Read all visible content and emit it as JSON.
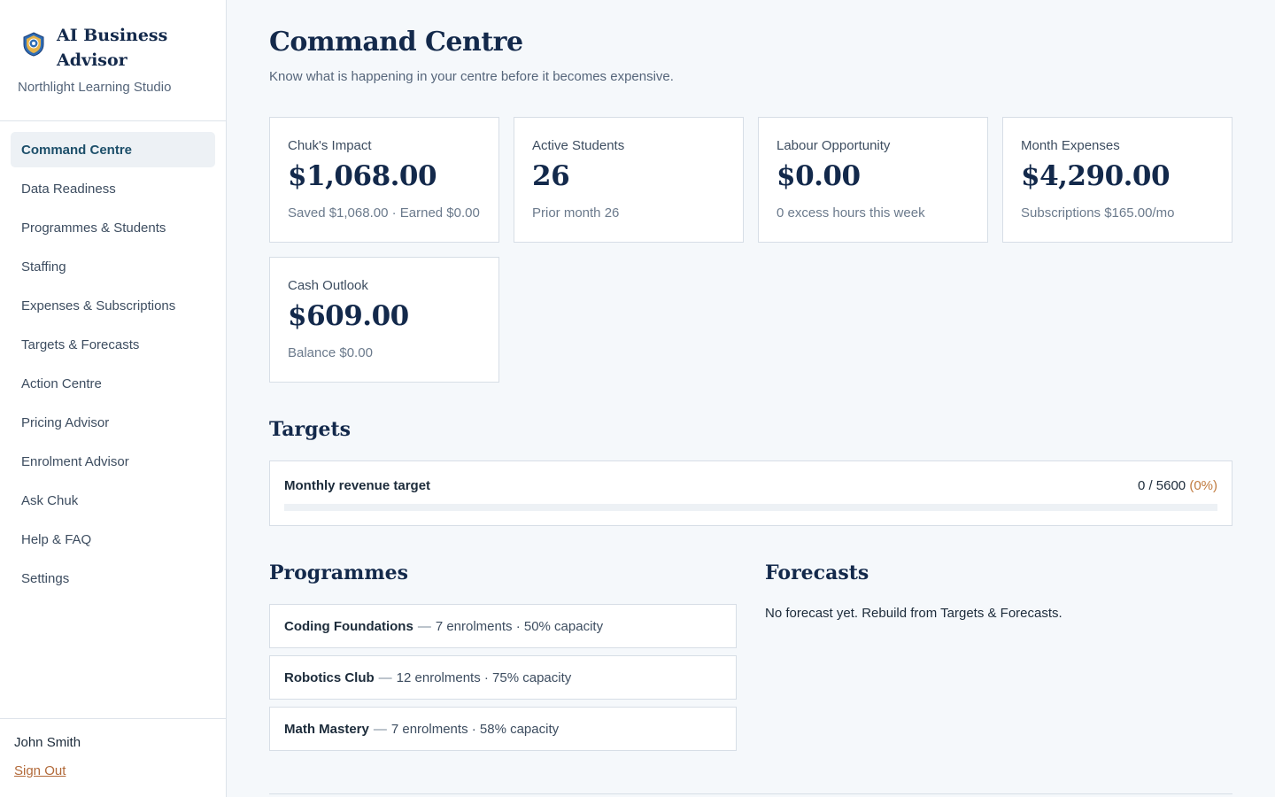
{
  "brand": {
    "title": "AI Business Advisor",
    "org": "Northlight Learning Studio"
  },
  "nav": {
    "items": [
      {
        "label": "Command Centre",
        "active": true
      },
      {
        "label": "Data Readiness"
      },
      {
        "label": "Programmes & Students"
      },
      {
        "label": "Staffing"
      },
      {
        "label": "Expenses & Subscriptions"
      },
      {
        "label": "Targets & Forecasts"
      },
      {
        "label": "Action Centre"
      },
      {
        "label": "Pricing Advisor"
      },
      {
        "label": "Enrolment Advisor"
      },
      {
        "label": "Ask Chuk"
      },
      {
        "label": "Help & FAQ"
      },
      {
        "label": "Settings"
      }
    ]
  },
  "user": {
    "name": "John Smith",
    "sign_out": "Sign Out"
  },
  "page": {
    "title": "Command Centre",
    "subtitle": "Know what is happening in your centre before it becomes expensive."
  },
  "kpis": [
    {
      "label": "Chuk's Impact",
      "value": "$1,068.00",
      "note": "Saved $1,068.00 · Earned $0.00"
    },
    {
      "label": "Active Students",
      "value": "26",
      "note": "Prior month 26"
    },
    {
      "label": "Labour Opportunity",
      "value": "$0.00",
      "note": "0 excess hours this week"
    },
    {
      "label": "Month Expenses",
      "value": "$4,290.00",
      "note": "Subscriptions $165.00/mo"
    },
    {
      "label": "Cash Outlook",
      "value": "$609.00",
      "note": "Balance $0.00"
    }
  ],
  "targets": {
    "title": "Targets",
    "items": [
      {
        "label": "Monthly revenue target",
        "current": "0",
        "target": "5600",
        "display": "0 / 5600",
        "pct": "(0%)",
        "progress": 0
      }
    ]
  },
  "programmes": {
    "title": "Programmes",
    "separator": "—",
    "items": [
      {
        "name": "Coding Foundations",
        "detail": "7 enrolments · 50% capacity"
      },
      {
        "name": "Robotics Club",
        "detail": "12 enrolments · 75% capacity"
      },
      {
        "name": "Math Mastery",
        "detail": "7 enrolments · 58% capacity"
      }
    ]
  },
  "forecasts": {
    "title": "Forecasts",
    "empty": "No forecast yet. Rebuild from Targets & Forecasts."
  },
  "colors": {
    "navy": "#13294b",
    "accent": "#1d4f6a",
    "link": "#b26a3a",
    "pct": "#c07a3e"
  },
  "icons": {
    "logo": "shield-logo-icon"
  }
}
